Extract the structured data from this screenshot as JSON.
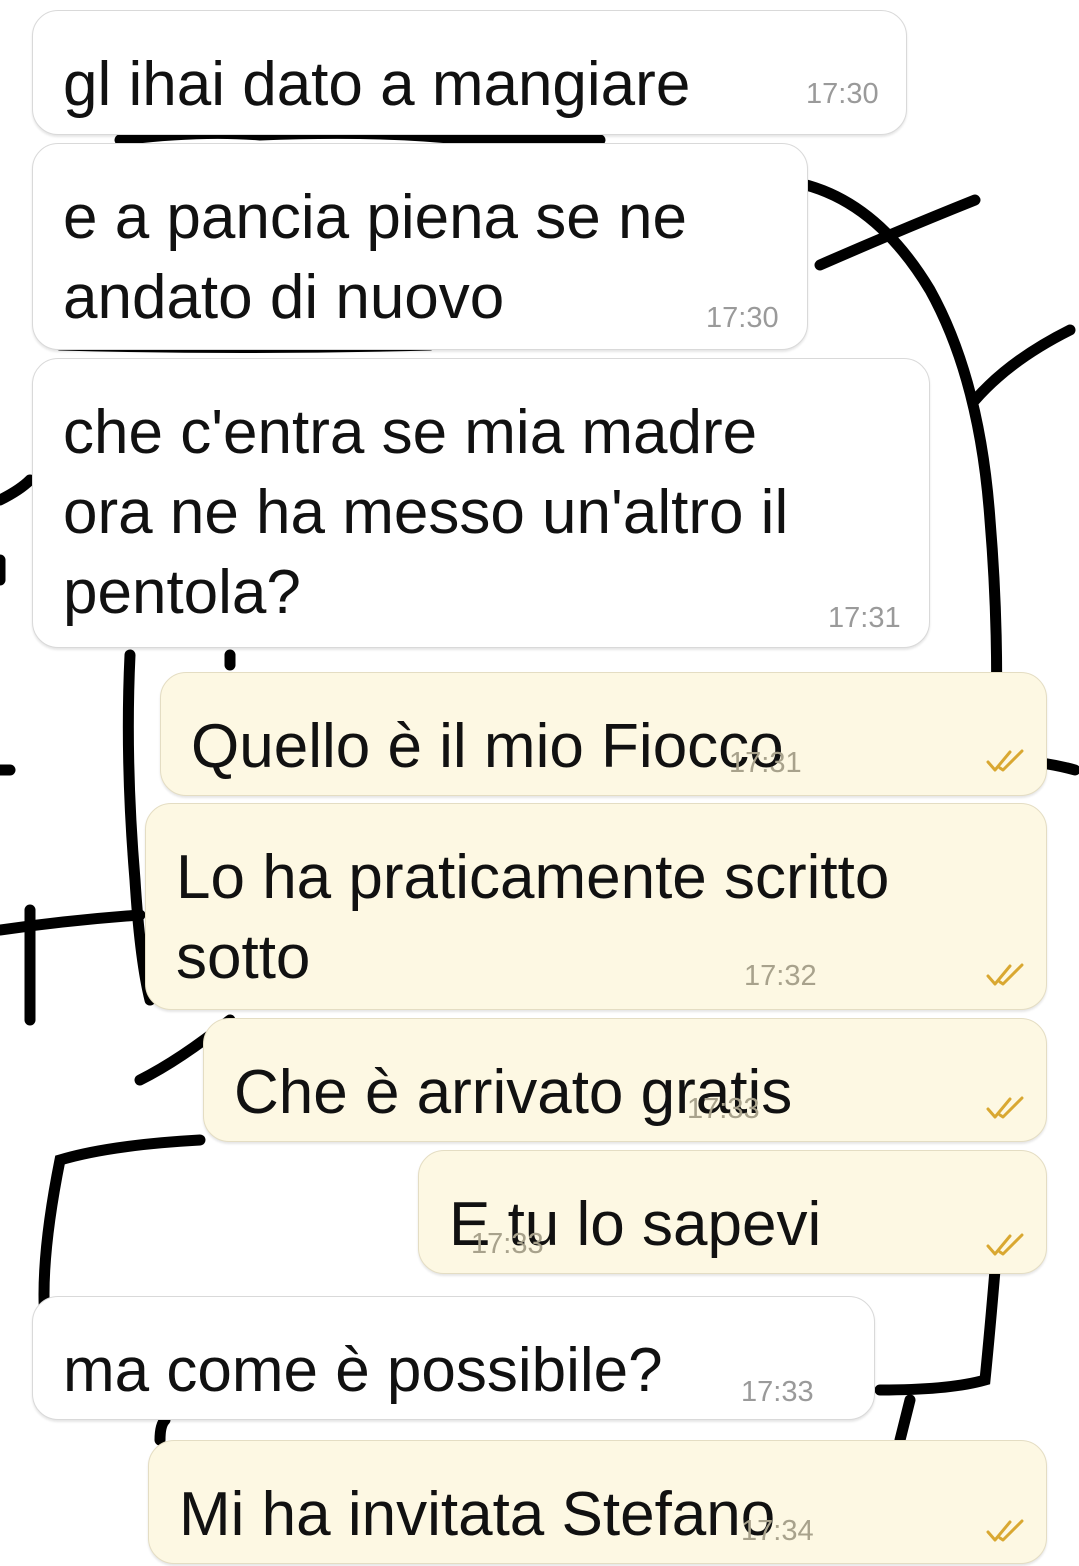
{
  "messages": [
    {
      "direction": "in",
      "text": "gl ihai dato a mangiare",
      "time": "17:30"
    },
    {
      "direction": "in",
      "text": "e a pancia piena se ne\nandato di nuovo",
      "time": "17:30"
    },
    {
      "direction": "in",
      "text": "che c'entra se mia madre\nora ne ha messo un'altro il\npentola?",
      "time": "17:31"
    },
    {
      "direction": "out",
      "text": "Quello è il mio Fiocco",
      "time": "17:31",
      "status": "read-ticks-icon"
    },
    {
      "direction": "out",
      "text": "Lo ha praticamente scritto\nsotto",
      "time": "17:32",
      "status": "read-ticks-icon"
    },
    {
      "direction": "out",
      "text": "Che è arrivato gratis",
      "time": "17:33",
      "status": "read-ticks-icon"
    },
    {
      "direction": "out",
      "text": "E tu lo sapevi",
      "time": "17:33",
      "status": "read-ticks-icon"
    },
    {
      "direction": "in",
      "text": "ma come è possibile?",
      "time": "17:33"
    },
    {
      "direction": "out",
      "text": "Mi ha invitata Stefano",
      "time": "17:34",
      "status": "read-ticks-icon"
    }
  ],
  "colors": {
    "incoming_bubble": "#ffffff",
    "outgoing_bubble": "#fdf8e3",
    "read_ticks": "#d9a832",
    "timestamp": "#9a9a9a"
  }
}
